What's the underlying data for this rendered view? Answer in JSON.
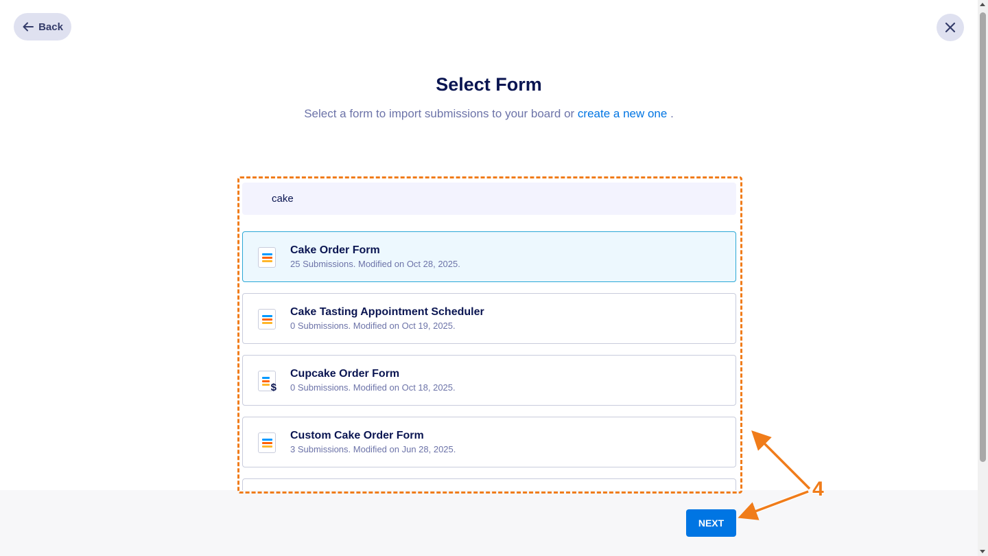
{
  "nav": {
    "back_label": "Back"
  },
  "header": {
    "title": "Select Form",
    "subtitle_prefix": "Select a form to import submissions to your board or ",
    "subtitle_link": "create a new one",
    "subtitle_suffix": " ."
  },
  "search": {
    "value": "cake"
  },
  "forms": [
    {
      "name": "Cake Order Form",
      "meta": "25 Submissions. Modified on Oct 28, 2025.",
      "icon": "form-icon",
      "selected": true
    },
    {
      "name": "Cake Tasting Appointment Scheduler",
      "meta": "0 Submissions. Modified on Oct 19, 2025.",
      "icon": "form-icon",
      "selected": false
    },
    {
      "name": "Cupcake Order Form",
      "meta": "0 Submissions. Modified on Oct 18, 2025.",
      "icon": "payment-form-icon",
      "selected": false
    },
    {
      "name": "Custom Cake Order Form",
      "meta": "3 Submissions. Modified on Jun 28, 2025.",
      "icon": "form-icon",
      "selected": false
    }
  ],
  "footer": {
    "next_label": "NEXT"
  },
  "annotation": {
    "step": "4",
    "color": "#f07c1a"
  },
  "colors": {
    "accent": "#0075e3",
    "selected_bg": "#edf8fe",
    "selected_border": "#2aa7d6",
    "highlight": "#f07c1a"
  }
}
